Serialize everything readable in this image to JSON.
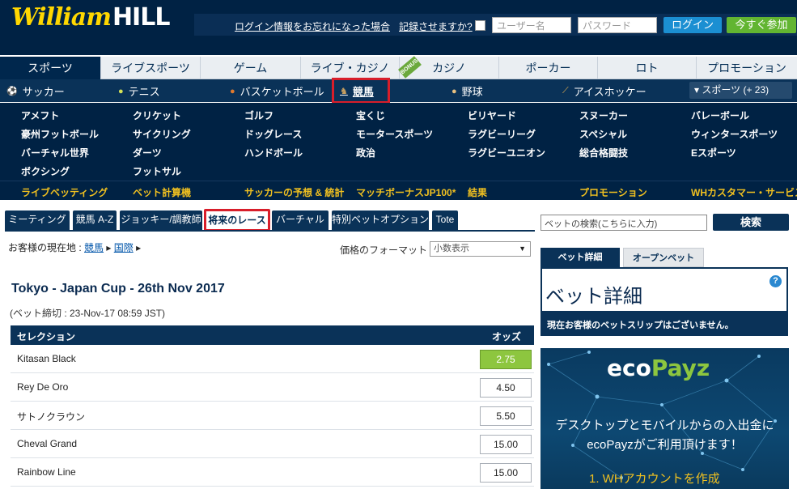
{
  "brand": {
    "script": "William",
    "bold": "HILL"
  },
  "header": {
    "forgot_login": "ログイン情報をお忘れになった場合",
    "remember": "記録させますか?",
    "username_placeholder": "ユーザー名",
    "password_placeholder": "パスワード",
    "login": "ログイン",
    "join": "今すぐ参加"
  },
  "main_tabs": [
    "スポーツ",
    "ライブスポーツ",
    "ゲーム",
    "ライブ・カジノ",
    "カジノ",
    "ポーカー",
    "ロト",
    "プロモーション"
  ],
  "bonus_ribbon": "BONUS",
  "sports_nav": [
    "サッカー",
    "テニス",
    "バスケットボール",
    "競馬",
    "野球",
    "アイスホッケー"
  ],
  "more_sports": "▾ スポーツ (+ 23)",
  "sub_sports": [
    [
      "アメフト",
      "クリケット",
      "ゴルフ",
      "宝くじ",
      "ビリヤード",
      "スヌーカー",
      "バレーボール"
    ],
    [
      "豪州フットボール",
      "サイクリング",
      "ドッグレース",
      "モータースポーツ",
      "ラグビーリーグ",
      "スペシャル",
      "ウィンタースポーツ"
    ],
    [
      "バーチャル世界",
      "ダーツ",
      "ハンドボール",
      "政治",
      "ラグビーユニオン",
      "総合格闘技",
      "Eスポーツ"
    ],
    [
      "ボクシング",
      "フットサル"
    ]
  ],
  "quick_links": [
    "ライブベッティング",
    "ベット計算機",
    "サッカーの予想 & 統計",
    "マッチボーナスJP100*",
    "結果",
    "プロモーション",
    "WHカスタマー・サービス"
  ],
  "sub_tabs": [
    "ミーティング",
    "競馬 A-Z",
    "ジョッキー/調教師",
    "将来のレース",
    "バーチャル",
    "特別ベットオプション",
    "Tote"
  ],
  "breadcrumb": {
    "label": "お客様の現在地 :",
    "items": [
      "競馬",
      "国際"
    ]
  },
  "price_format": {
    "label": "価格のフォーマット :",
    "value": "小数表示"
  },
  "race": {
    "title": "Tokyo - Japan Cup - 26th Nov 2017",
    "close": "(ベット締切 : 23-Nov-17 08:59 JST)"
  },
  "odds_table": {
    "col_selection": "セレクション",
    "col_odds": "オッズ",
    "rows": [
      {
        "name": "Kitasan Black",
        "odds": "2.75"
      },
      {
        "name": "Rey De Oro",
        "odds": "4.50"
      },
      {
        "name": "サトノクラウン",
        "odds": "5.50"
      },
      {
        "name": "Cheval Grand",
        "odds": "15.00"
      },
      {
        "name": "Rainbow Line",
        "odds": "15.00"
      }
    ]
  },
  "search": {
    "placeholder": "ベットの検索(こちらに入力)",
    "button": "検索"
  },
  "betslip": {
    "tab_active": "ベット詳細",
    "tab_inactive": "オープンベット",
    "heading": "ベット詳細",
    "help": "?",
    "empty": "現在お客様のベットスリップはございません。"
  },
  "ad": {
    "logo_a": "eco",
    "logo_b": "Payz",
    "line1": "デスクトップとモバイルからの入出金に",
    "line2": "ecoPayzがご利用頂けます！",
    "step": "1. WHアカウントを作成"
  },
  "colors": {
    "navy": "#002244",
    "gold": "#f0c020",
    "green": "#8dc63f",
    "highlight_red": "#d81e2a"
  }
}
